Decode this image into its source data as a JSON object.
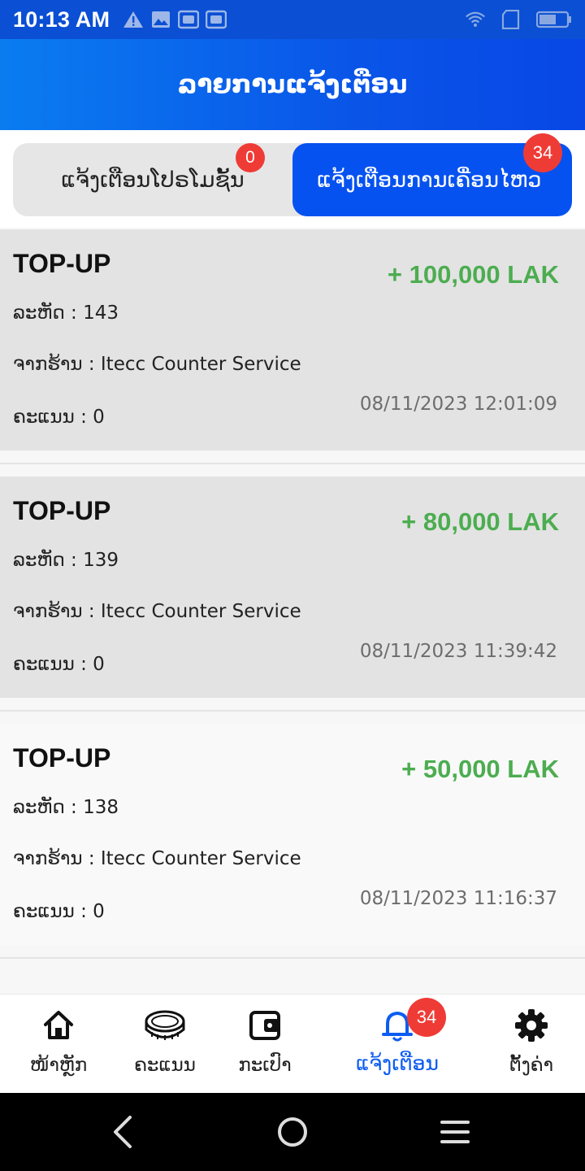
{
  "status_bar": {
    "time": "10:13 AM",
    "left_icons": [
      "warning-icon",
      "image-icon",
      "photo-frame-icon",
      "photo-frame-icon"
    ],
    "right_icons": [
      "wifi-icon",
      "sim-icon",
      "battery-icon"
    ]
  },
  "header": {
    "title": "ລາຍການແຈ້ງເຕືອນ"
  },
  "tabs": {
    "promo": {
      "label": "ແຈ້ງເຕືອນໂປຣໂມຊັ້ນ",
      "badge": "0"
    },
    "transactions": {
      "label": "ແຈ້ງເຕືອນການເຄື່ອນໄຫວ",
      "badge": "34"
    }
  },
  "notifications": [
    {
      "title": "TOP-UP",
      "amount": "+ 100,000 LAK",
      "code_line": "ລະຫັດ : 143",
      "shop_line": "ຈາກຮ້ານ : Itecc Counter Service",
      "points_line": "ຄະແນນ : 0",
      "datetime": "08/11/2023 12:01:09"
    },
    {
      "title": "TOP-UP",
      "amount": "+ 80,000 LAK",
      "code_line": "ລະຫັດ : 139",
      "shop_line": "ຈາກຮ້ານ : Itecc Counter Service",
      "points_line": "ຄະແນນ : 0",
      "datetime": "08/11/2023 11:39:42"
    },
    {
      "title": "TOP-UP",
      "amount": "+ 50,000 LAK",
      "code_line": "ລະຫັດ : 138",
      "shop_line": "ຈາກຮ້ານ : Itecc Counter Service",
      "points_line": "ຄະແນນ : 0",
      "datetime": "08/11/2023 11:16:37"
    }
  ],
  "bottom_nav": {
    "items": [
      {
        "label": "ໜ້າຫຼັກ",
        "icon": "home-icon"
      },
      {
        "label": "ຄະແນນ",
        "icon": "coin-icon"
      },
      {
        "label": "ກະເປົາ",
        "icon": "wallet-icon"
      },
      {
        "label": "ແຈ້ງເຕືອນ",
        "icon": "bell-icon",
        "badge": "34",
        "active": true
      },
      {
        "label": "ຕັ້ງຄ່າ",
        "icon": "gear-icon"
      }
    ]
  },
  "colors": {
    "header_gradient_start": "#0a7cf0",
    "header_gradient_end": "#0847e6",
    "active_tab": "#0652f0",
    "badge": "#ef3b36",
    "amount_green": "#4cad50",
    "active_nav": "#0c5cf2"
  }
}
